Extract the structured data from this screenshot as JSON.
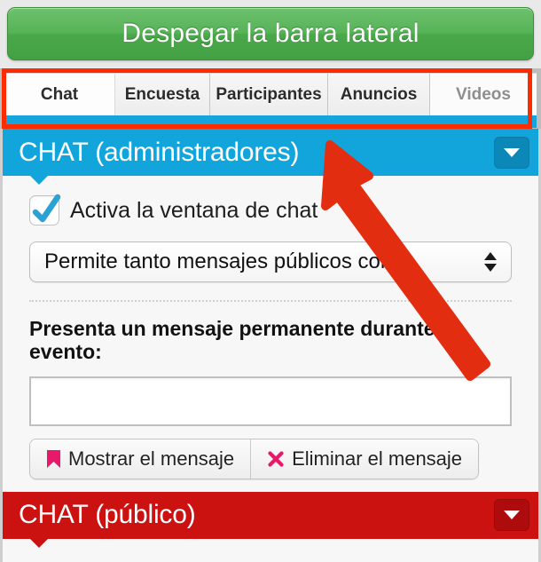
{
  "toolbar": {
    "toggle_sidebar_label": "Despegar la barra lateral"
  },
  "tabs": [
    {
      "label": "Chat",
      "state": "active"
    },
    {
      "label": "Encuesta",
      "state": "normal"
    },
    {
      "label": "Participantes",
      "state": "normal"
    },
    {
      "label": "Anuncios",
      "state": "normal"
    },
    {
      "label": "Videos",
      "state": "disabled"
    }
  ],
  "admin_section": {
    "title": "CHAT (administradores)",
    "accent_color": "#12a5dc",
    "checkbox": {
      "label": "Activa la ventana de chat",
      "checked": true
    },
    "permission_select": {
      "value": "Permite tanto mensajes públicos como"
    },
    "permanent_message": {
      "label": "Presenta un mensaje permanente durante el evento:",
      "input_value": "",
      "show_button_label": "Mostrar el mensaje",
      "delete_button_label": "Eliminar el mensaje"
    }
  },
  "public_section": {
    "title": "CHAT (público)",
    "accent_color": "#cc1111"
  },
  "annotations": {
    "highlight_color": "#fc2b00",
    "arrow_color": "#e32d10"
  },
  "icons": {
    "collapse": "chevron-down-icon",
    "bookmark": "bookmark-icon",
    "remove": "x-mark-icon",
    "check": "checkmark-icon",
    "select_stepper": "up-down-arrows-icon"
  }
}
